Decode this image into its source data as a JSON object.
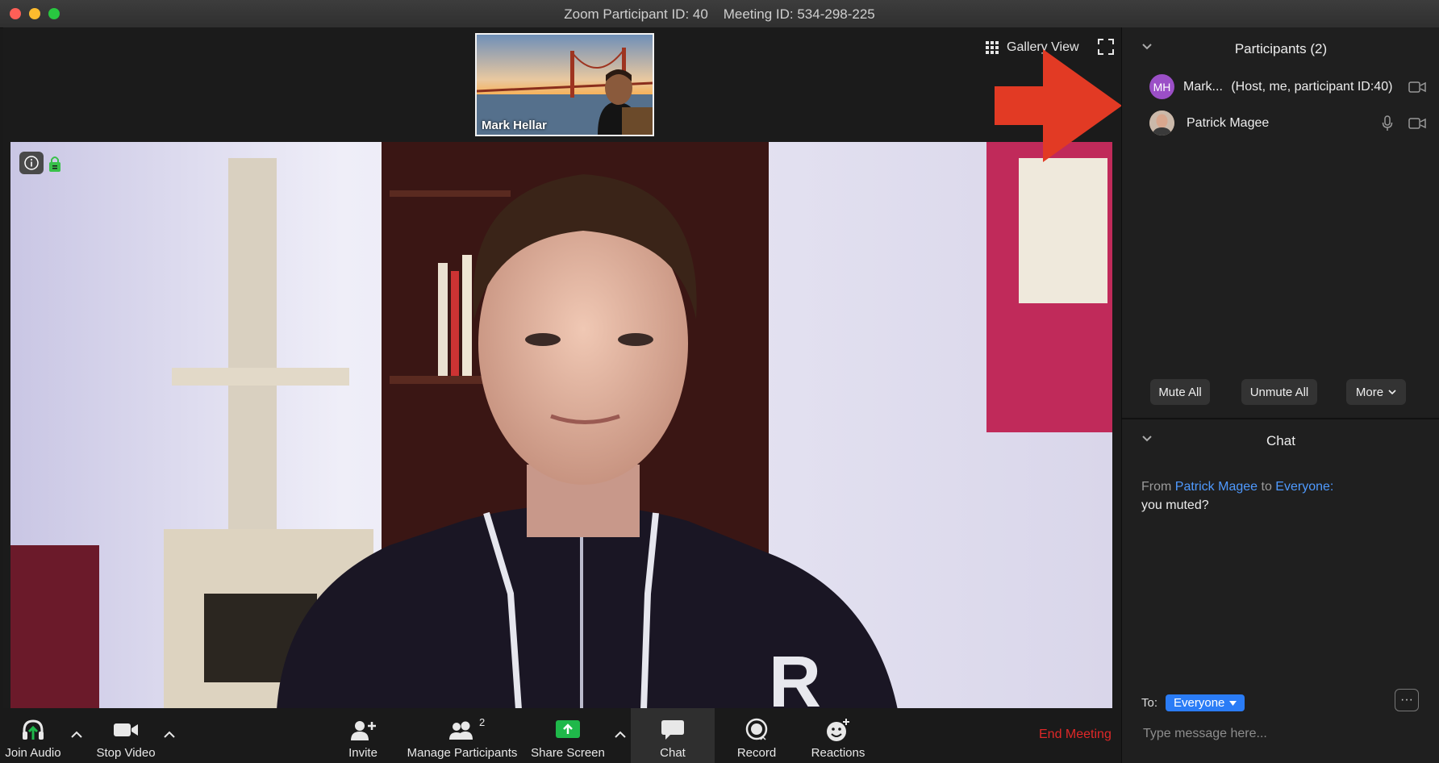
{
  "window": {
    "title": "Zoom Participant ID: 40    Meeting ID: 534-298-225"
  },
  "video": {
    "thumbnail_name": "Mark Hellar",
    "gallery_view_label": "Gallery View"
  },
  "toolbar": {
    "join_audio": "Join Audio",
    "stop_video": "Stop Video",
    "invite": "Invite",
    "manage_participants": "Manage Participants",
    "participant_count": "2",
    "share_screen": "Share Screen",
    "chat": "Chat",
    "record": "Record",
    "reactions": "Reactions",
    "end_meeting": "End Meeting",
    "share_color": "#1fb84a",
    "end_color": "#e02828"
  },
  "participants": {
    "title": "Participants (2)",
    "items": [
      {
        "initials": "MH",
        "name": "Mark...",
        "detail": "(Host, me, participant ID:40)",
        "avatar_color": "#9b4fc7"
      },
      {
        "initials": "",
        "name": "Patrick Magee",
        "detail": ""
      }
    ],
    "mute_all": "Mute All",
    "unmute_all": "Unmute All",
    "more": "More"
  },
  "chat": {
    "title": "Chat",
    "from_label": "From",
    "sender": "Patrick Magee",
    "to_label": "to",
    "recipient": "Everyone:",
    "message": "you muted?",
    "to_prefix": "To:",
    "to_value": "Everyone",
    "placeholder": "Type message here...",
    "accent": "#2a7cf6"
  },
  "annotation": {
    "arrow_color": "#e23a24"
  }
}
